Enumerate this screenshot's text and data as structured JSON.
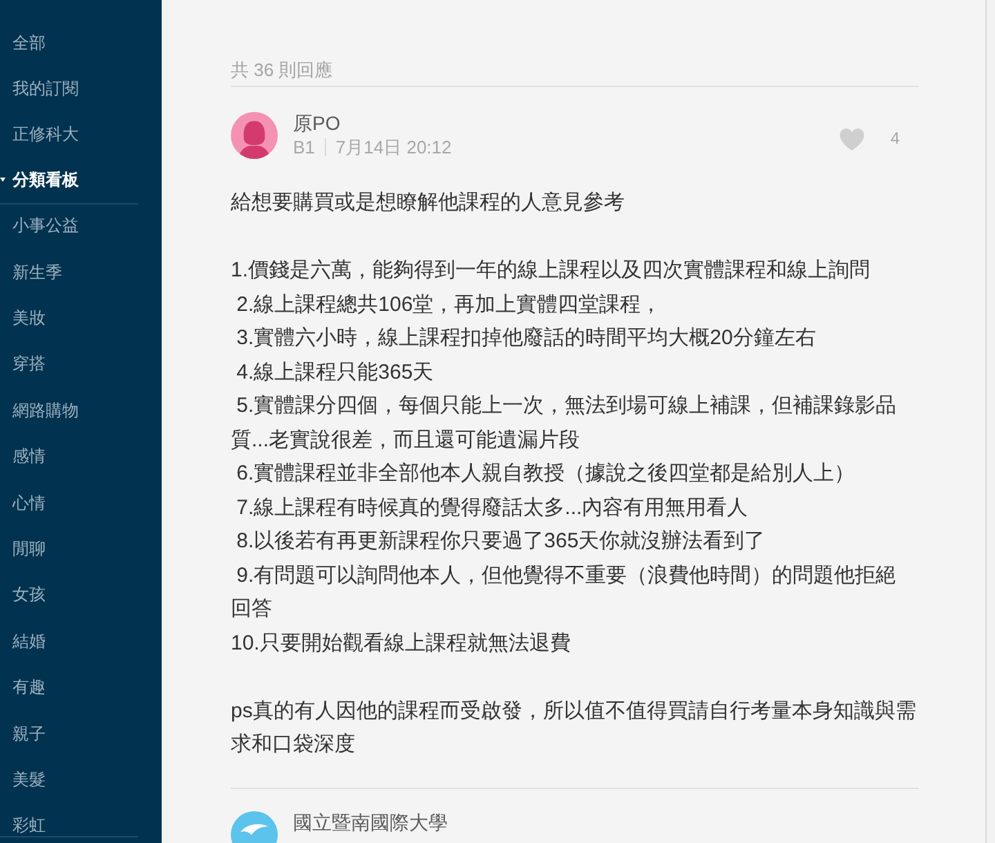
{
  "sidebar": {
    "items": [
      "全部",
      "我的訂閱",
      "正修科大"
    ],
    "section": {
      "title": "分類看板",
      "expanded": true,
      "items": [
        "小事公益",
        "新生季",
        "美妝",
        "穿搭",
        "網路購物",
        "感情",
        "心情",
        "閒聊",
        "女孩",
        "結婚",
        "有趣",
        "親子",
        "美髮",
        "彩虹"
      ]
    }
  },
  "replies": {
    "count_label": "共 36 則回應"
  },
  "posts": [
    {
      "author": "原PO",
      "avatar": {
        "kind": "female"
      },
      "floor": "B1",
      "time": "7月14日 20:12",
      "liked": false,
      "likes": "4",
      "blocks": [
        [
          "給想要購買或是想瞭解他課程的人意見參考"
        ],
        [
          "1.價錢是六萬，能夠得到一年的線上課程以及四次實體課程和線上詢問",
          " 2.線上課程總共106堂，再加上實體四堂課程，",
          " 3.實體六小時，線上課程扣掉他廢話的時間平均大概20分鐘左右",
          " 4.線上課程只能365天",
          " 5.實體課分四個，每個只能上一次，無法到場可線上補課，但補課錄影品質...老實說很差，而且還可能遺漏片段",
          " 6.實體課程並非全部他本人親自教授（據說之後四堂都是給別人上）",
          " 7.線上課程有時候真的覺得廢話太多...內容有用無用看人",
          " 8.以後若有再更新課程你只要過了365天你就沒辦法看到了",
          " 9.有問題可以詢問他本人，但他覺得不重要（浪費他時間）的問題他拒絕回答",
          "10.只要開始觀看線上課程就無法退費"
        ],
        [
          "ps真的有人因他的課程而受啟發，所以值不值得買請自行考量本身知識與需求和口袋深度"
        ]
      ]
    },
    {
      "author": "國立暨南國際大學",
      "avatar": {
        "kind": "school"
      }
    }
  ]
}
